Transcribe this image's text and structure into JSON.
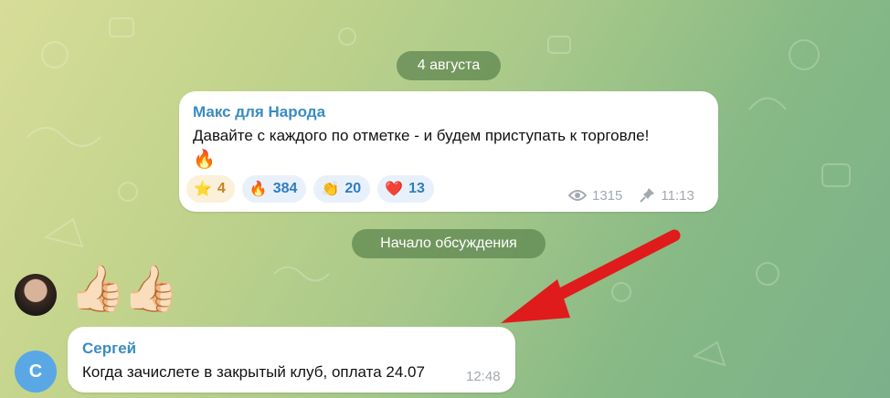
{
  "chat": {
    "date_label": "4 августа",
    "discussion_label": "Начало обсуждения"
  },
  "post": {
    "author": "Макс для Народа",
    "text": "Давайте с каждого по отметке - и будем приступать к торговле!",
    "emoji": "🔥",
    "reactions": [
      {
        "emoji": "⭐",
        "count": "4"
      },
      {
        "emoji": "🔥",
        "count": "384"
      },
      {
        "emoji": "👏",
        "count": "20"
      },
      {
        "emoji": "❤️",
        "count": "13"
      }
    ],
    "views": "1315",
    "time": "11:13"
  },
  "sticker_message": {
    "emoji": "👍🏻👍🏻"
  },
  "comment": {
    "author": "Сергей",
    "avatar_letter": "С",
    "text": "Когда  зачислете в закрытый клуб, оплата 24.07",
    "time": "12:48"
  },
  "colors": {
    "accent": "#3a8bc3",
    "arrow": "#e01b1b",
    "avatar_bg": "#5aa7e6"
  }
}
